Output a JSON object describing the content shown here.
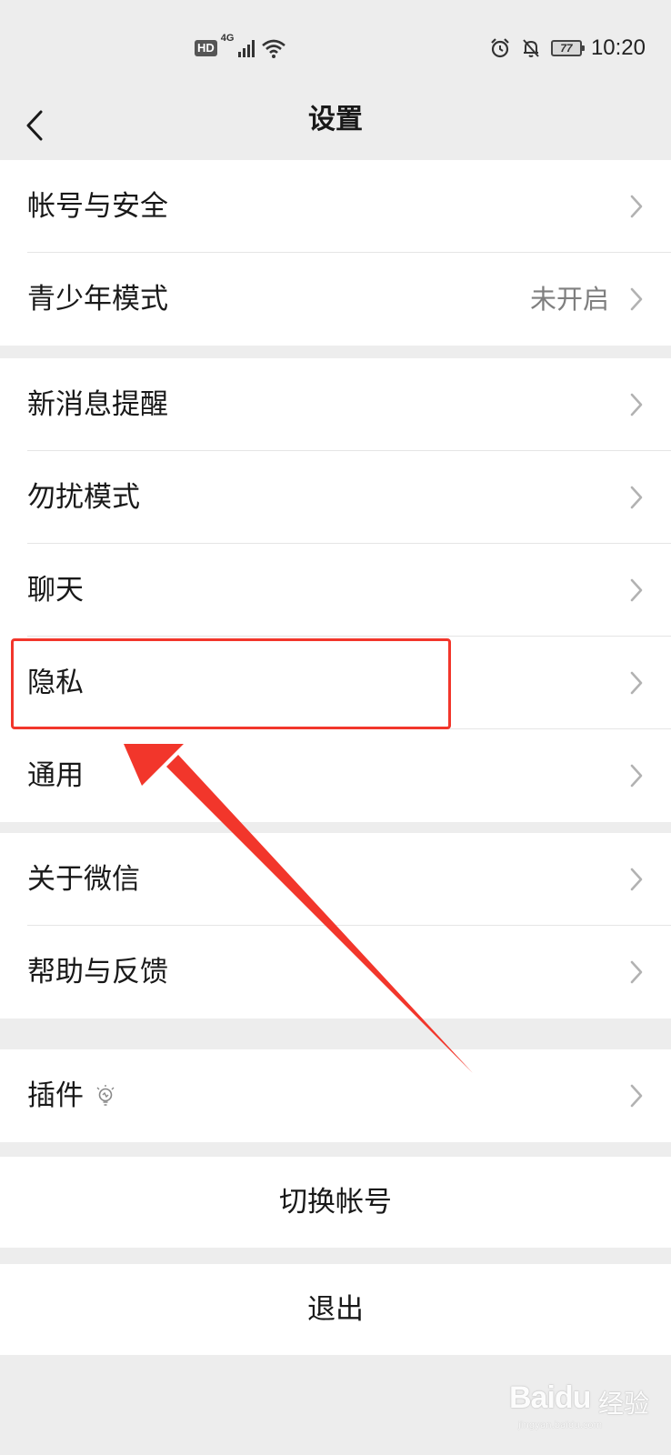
{
  "status_bar": {
    "hd": "HD",
    "network": "4G",
    "battery": "77",
    "time": "10:20"
  },
  "nav": {
    "title": "设置"
  },
  "groups": {
    "account": [
      {
        "label": "帐号与安全"
      },
      {
        "label": "青少年模式",
        "value": "未开启"
      }
    ],
    "notifications": [
      {
        "label": "新消息提醒"
      },
      {
        "label": "勿扰模式"
      },
      {
        "label": "聊天"
      },
      {
        "label": "隐私"
      },
      {
        "label": "通用"
      }
    ],
    "about": [
      {
        "label": "关于微信"
      },
      {
        "label": "帮助与反馈"
      }
    ],
    "plugins": [
      {
        "label": "插件"
      }
    ]
  },
  "actions": {
    "switch_account": "切换帐号",
    "logout": "退出"
  },
  "watermark": {
    "brand": "Baidu",
    "cn": "经验",
    "url": "jingyan.baidu.com"
  },
  "colors": {
    "background": "#ededed",
    "annotation": "#f2362b",
    "secondary_text": "#7f7f7f"
  }
}
